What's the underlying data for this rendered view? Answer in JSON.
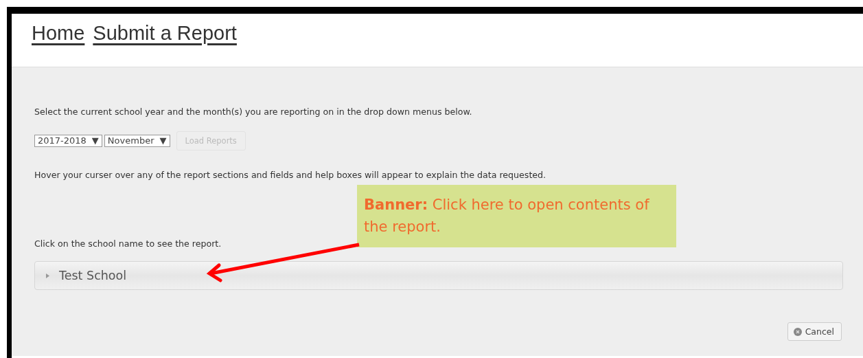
{
  "breadcrumbs": [
    {
      "label": "Home"
    },
    {
      "label": "Submit a Report"
    }
  ],
  "instructions": "Select the current school year and the month(s) you are reporting on in the drop down menus below.",
  "year_select": {
    "value": "2017-2018",
    "arrow": "▼"
  },
  "month_select": {
    "value": "November",
    "arrow": "▼"
  },
  "load_button": {
    "label": "Load Reports",
    "disabled": true
  },
  "hover_hint": "Hover your curser over any of the report sections and fields and help boxes will appear to explain the data requested.",
  "school_hint": "Click on the school name to see the report.",
  "schools": [
    {
      "name": "Test School",
      "expanded": false
    }
  ],
  "cancel_button": {
    "label": "Cancel"
  },
  "callout": {
    "text": "**Banner:** Click here to open contents of the report."
  }
}
